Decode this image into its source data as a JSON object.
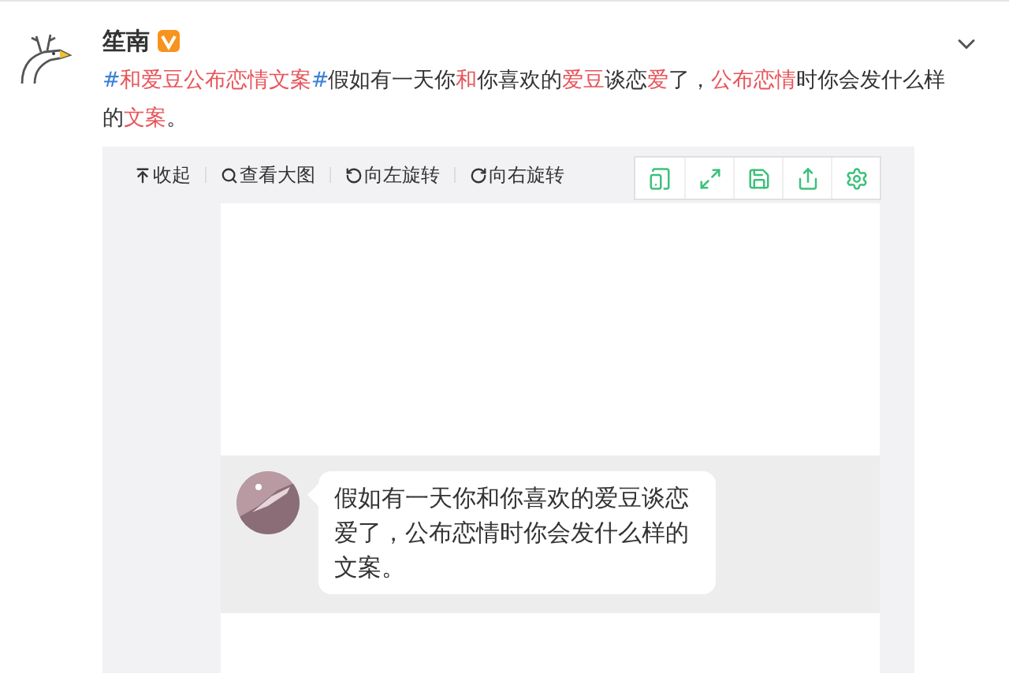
{
  "post": {
    "author": "笙南",
    "verified": true,
    "segments": [
      {
        "text": "#",
        "kind": "hash"
      },
      {
        "text": "和爱豆公布恋情文案",
        "kind": "keyword"
      },
      {
        "text": "#",
        "kind": "hash"
      },
      {
        "text": "假如有一天你",
        "kind": "plain"
      },
      {
        "text": "和",
        "kind": "keyword"
      },
      {
        "text": "你喜欢的",
        "kind": "plain"
      },
      {
        "text": "爱豆",
        "kind": "keyword"
      },
      {
        "text": "谈恋",
        "kind": "plain"
      },
      {
        "text": "爱",
        "kind": "keyword"
      },
      {
        "text": "了，",
        "kind": "plain"
      },
      {
        "text": "公布恋情",
        "kind": "keyword"
      },
      {
        "text": "时你会发什么样的",
        "kind": "plain"
      },
      {
        "text": "文案",
        "kind": "keyword"
      },
      {
        "text": "。",
        "kind": "plain"
      }
    ]
  },
  "viewer": {
    "toolbar": [
      {
        "label": "收起",
        "kind": "collapse"
      },
      {
        "label": "查看大图",
        "kind": "zoom"
      },
      {
        "label": "向左旋转",
        "kind": "rotate-left"
      },
      {
        "label": "向右旋转",
        "kind": "rotate-right"
      }
    ],
    "actions": [
      {
        "kind": "tablet"
      },
      {
        "kind": "expand"
      },
      {
        "kind": "save"
      },
      {
        "kind": "share"
      },
      {
        "kind": "settings"
      }
    ],
    "image": {
      "message": "假如有一天你和你喜欢的爱豆谈恋爱了，公布恋情时你会发什么样的文案。"
    }
  }
}
